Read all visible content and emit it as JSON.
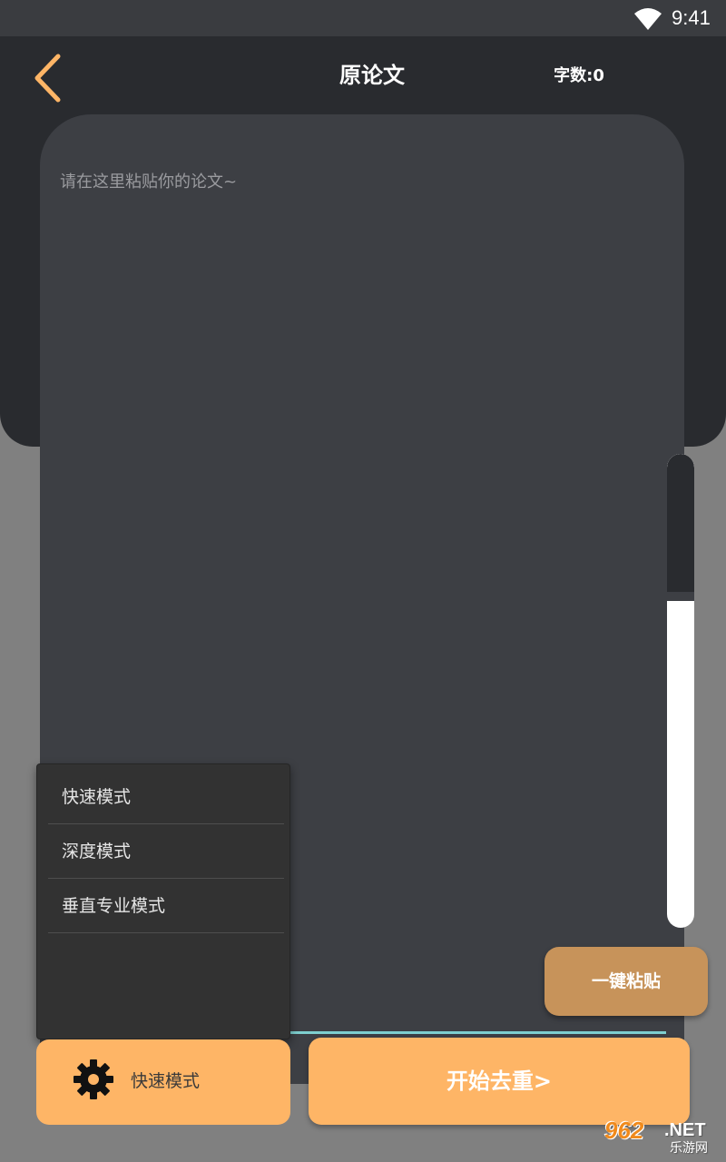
{
  "status_bar": {
    "time": "9:41",
    "wifi_icon": "wifi-icon"
  },
  "header": {
    "back_icon": "chevron-left-icon",
    "title": "原论文",
    "word_count": "字数:0"
  },
  "editor": {
    "placeholder": "请在这里粘贴你的论文~",
    "value": ""
  },
  "paste_button": {
    "label": "一键粘贴"
  },
  "mode_menu": {
    "items": [
      {
        "label": "快速模式"
      },
      {
        "label": "深度模式"
      },
      {
        "label": "垂直专业模式"
      }
    ]
  },
  "mode_button": {
    "icon": "gear-icon",
    "label": "快速模式"
  },
  "start_button": {
    "label": "开始去重>"
  },
  "watermark": {
    "number": "962",
    "suffix": ".NET",
    "caption": "乐游网"
  },
  "colors": {
    "accent": "#feb566",
    "paste_button": "#c7935a",
    "header_bg": "#292b2f",
    "editor_bg": "#3d3f44",
    "menu_bg": "#323232",
    "underline": "#7ecfcf"
  }
}
